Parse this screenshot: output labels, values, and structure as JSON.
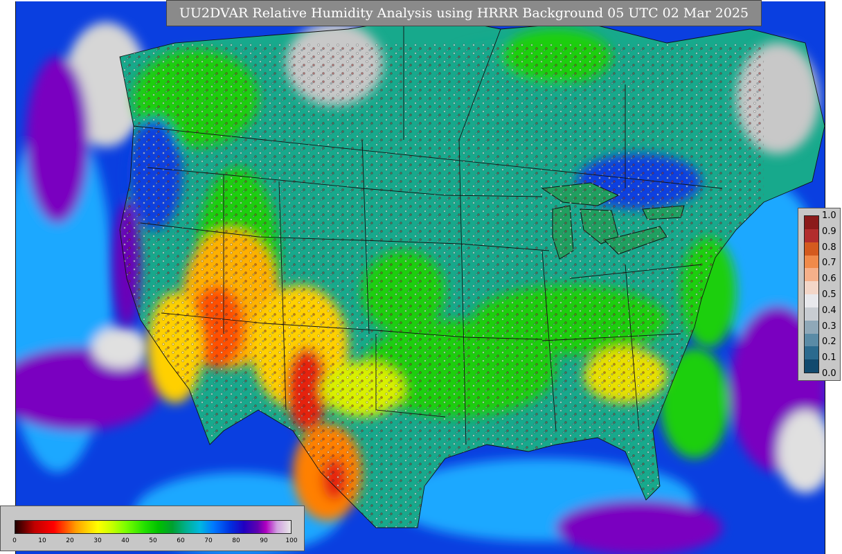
{
  "title": "UU2DVAR Relative Humidity Analysis using HRRR Background 05 UTC 02 Mar 2025",
  "right_colorbar": {
    "ticks": [
      "1.0",
      "0.9",
      "0.8",
      "0.7",
      "0.6",
      "0.5",
      "0.4",
      "0.3",
      "0.2",
      "0.1",
      "0.0"
    ],
    "colors": [
      "#8b1a1a",
      "#b22d2d",
      "#d45a1e",
      "#f08a4a",
      "#f5b08a",
      "#f3d6c8",
      "#e8e8ec",
      "#c8ccd2",
      "#8fa8b8",
      "#5a8ba6",
      "#2b6a8e",
      "#114a6e"
    ]
  },
  "bottom_colorbar": {
    "ticks": [
      "0",
      "10",
      "20",
      "30",
      "40",
      "50",
      "60",
      "70",
      "80",
      "90",
      "100"
    ]
  },
  "colors": {
    "ocean_blue": "#0a3fe0",
    "ocean_light": "#1aa8ff",
    "land_green": "#1fcf10",
    "land_teal": "#17a98c",
    "arid_orange": "#ff9a00",
    "arid_red": "#e52010",
    "moist_purple": "#6a00b8",
    "saturated_grey": "#c8c8c8"
  }
}
